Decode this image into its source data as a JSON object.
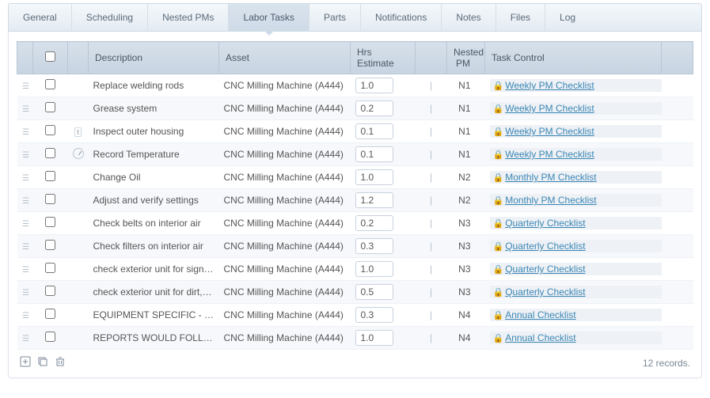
{
  "tabs": [
    {
      "label": "General",
      "active": false
    },
    {
      "label": "Scheduling",
      "active": false
    },
    {
      "label": "Nested PMs",
      "active": false
    },
    {
      "label": "Labor Tasks",
      "active": true
    },
    {
      "label": "Parts",
      "active": false
    },
    {
      "label": "Notifications",
      "active": false
    },
    {
      "label": "Notes",
      "active": false
    },
    {
      "label": "Files",
      "active": false
    },
    {
      "label": "Log",
      "active": false
    }
  ],
  "columns": {
    "description": "Description",
    "asset": "Asset",
    "hrs": "Hrs Estimate",
    "nested": "Nested PM",
    "task": "Task Control"
  },
  "rows": [
    {
      "extra": "",
      "desc": "Replace welding rods",
      "asset": "CNC Milling Machine (A444)",
      "hrs": "1.0",
      "nested": "N1",
      "task": "Weekly PM Checklist"
    },
    {
      "extra": "",
      "desc": "Grease system",
      "asset": "CNC Milling Machine (A444)",
      "hrs": "0.2",
      "nested": "N1",
      "task": "Weekly PM Checklist"
    },
    {
      "extra": "chip",
      "desc": "Inspect outer housing",
      "asset": "CNC Milling Machine (A444)",
      "hrs": "0.1",
      "nested": "N1",
      "task": "Weekly PM Checklist"
    },
    {
      "extra": "gauge",
      "desc": "Record Temperature",
      "asset": "CNC Milling Machine (A444)",
      "hrs": "0.1",
      "nested": "N1",
      "task": "Weekly PM Checklist"
    },
    {
      "extra": "",
      "desc": "Change Oil",
      "asset": "CNC Milling Machine (A444)",
      "hrs": "1.0",
      "nested": "N2",
      "task": "Monthly PM Checklist"
    },
    {
      "extra": "",
      "desc": "Adjust and verify settings",
      "asset": "CNC Milling Machine (A444)",
      "hrs": "1.2",
      "nested": "N2",
      "task": "Monthly PM Checklist"
    },
    {
      "extra": "",
      "desc": "Check belts on interior air",
      "asset": "CNC Milling Machine (A444)",
      "hrs": "0.2",
      "nested": "N3",
      "task": "Quarterly Checklist"
    },
    {
      "extra": "",
      "desc": "Check filters on interior air",
      "asset": "CNC Milling Machine (A444)",
      "hrs": "0.3",
      "nested": "N3",
      "task": "Quarterly Checklist"
    },
    {
      "extra": "",
      "desc": "check exterior unit for signs of...",
      "asset": "CNC Milling Machine (A444)",
      "hrs": "1.0",
      "nested": "N3",
      "task": "Quarterly Checklist"
    },
    {
      "extra": "",
      "desc": "check exterior unit for dirt, de...",
      "asset": "CNC Milling Machine (A444)",
      "hrs": "0.5",
      "nested": "N3",
      "task": "Quarterly Checklist"
    },
    {
      "extra": "",
      "desc": "EQUIPMENT SPECIFIC - VEND...",
      "asset": "CNC Milling Machine (A444)",
      "hrs": "0.3",
      "nested": "N4",
      "task": "Annual Checklist"
    },
    {
      "extra": "",
      "desc": "REPORTS WOULD FOLLOW AN...",
      "asset": "CNC Milling Machine (A444)",
      "hrs": "1.0",
      "nested": "N4",
      "task": "Annual Checklist"
    }
  ],
  "footer": {
    "records": "12 records."
  },
  "icons": {
    "add": "add-icon",
    "copy": "copy-icon",
    "delete": "trash-icon"
  }
}
